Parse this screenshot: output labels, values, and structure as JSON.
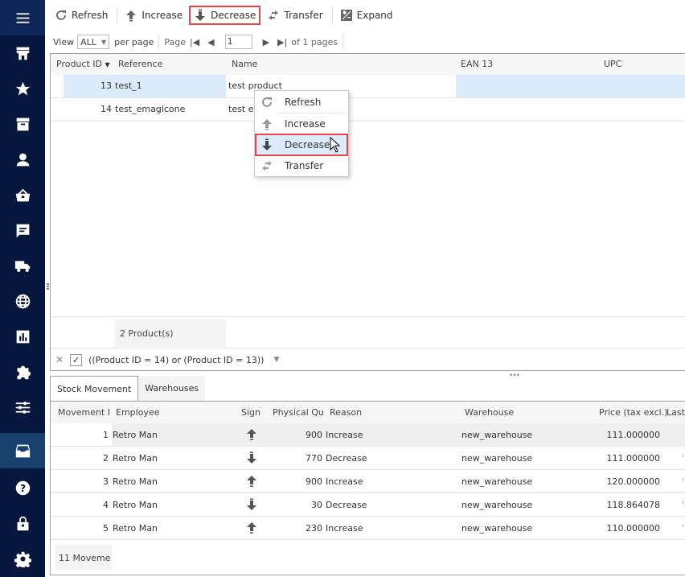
{
  "sidebar": {
    "items": [
      {
        "icon": "menu-icon"
      },
      {
        "icon": "store-icon"
      },
      {
        "icon": "star-icon"
      },
      {
        "icon": "inbox-archive-icon"
      },
      {
        "icon": "user-icon"
      },
      {
        "icon": "basket-icon"
      },
      {
        "icon": "chat-icon"
      },
      {
        "icon": "truck-icon"
      },
      {
        "icon": "globe-icon"
      },
      {
        "icon": "bar-chart-icon"
      },
      {
        "icon": "puzzle-icon"
      },
      {
        "icon": "sliders-icon"
      },
      {
        "icon": "inbox-icon",
        "active": true
      },
      {
        "icon": "help-icon"
      },
      {
        "icon": "lock-icon"
      },
      {
        "icon": "gear-icon"
      }
    ]
  },
  "toolbar": {
    "refresh": "Refresh",
    "increase": "Increase",
    "decrease": "Decrease",
    "transfer": "Transfer",
    "expand": "Expand"
  },
  "pager": {
    "view_label": "View",
    "view_value": "ALL",
    "per_page": "per page",
    "page_label": "Page",
    "page_value": "1",
    "of_pages": "of 1 pages"
  },
  "products": {
    "columns": [
      "Product ID",
      "Reference",
      "Name",
      "EAN 13",
      "UPC"
    ],
    "rows": [
      {
        "id": "13",
        "reference": "test_1",
        "name": "test product",
        "ean13": "",
        "upc": ""
      },
      {
        "id": "14",
        "reference": "test_emagicone",
        "name": "test em",
        "ean13": "",
        "upc": ""
      }
    ],
    "summary": "2 Product(s)",
    "filter_expression": "((Product ID = 14) or (Product ID = 13))",
    "filter_enabled": true
  },
  "context_menu": {
    "items": [
      "Refresh",
      "Increase",
      "Decrease",
      "Transfer"
    ],
    "highlighted": "Decrease"
  },
  "tabs": [
    {
      "label": "Stock Movement",
      "active": true
    },
    {
      "label": "Warehouses",
      "active": false
    }
  ],
  "movements": {
    "columns": [
      "Movement I",
      "Employee",
      "Sign",
      "Physical Qu",
      "Reason",
      "Warehouse",
      "Price (tax excl.)",
      "Last"
    ],
    "rows": [
      {
        "id": "1",
        "employee": "Retro Man",
        "sign": "up",
        "qty": "900",
        "reason": "Increase",
        "warehouse": "new_warehouse",
        "price": "111.000000"
      },
      {
        "id": "2",
        "employee": "Retro Man",
        "sign": "down",
        "qty": "770",
        "reason": "Decrease",
        "warehouse": "new_warehouse",
        "price": "111.000000"
      },
      {
        "id": "3",
        "employee": "Retro Man",
        "sign": "up",
        "qty": "900",
        "reason": "Increase",
        "warehouse": "new_warehouse",
        "price": "120.000000"
      },
      {
        "id": "4",
        "employee": "Retro Man",
        "sign": "down",
        "qty": "30",
        "reason": "Decrease",
        "warehouse": "new_warehouse",
        "price": "118.864078"
      },
      {
        "id": "5",
        "employee": "Retro Man",
        "sign": "up",
        "qty": "230",
        "reason": "Increase",
        "warehouse": "new_warehouse",
        "price": "110.000000"
      }
    ],
    "summary": "11 Moveme"
  },
  "colors": {
    "sidebar_bg": "#06173d",
    "sidebar_active": "#17406f",
    "selection": "#dcebfb",
    "highlight_border": "#e04a4f"
  }
}
